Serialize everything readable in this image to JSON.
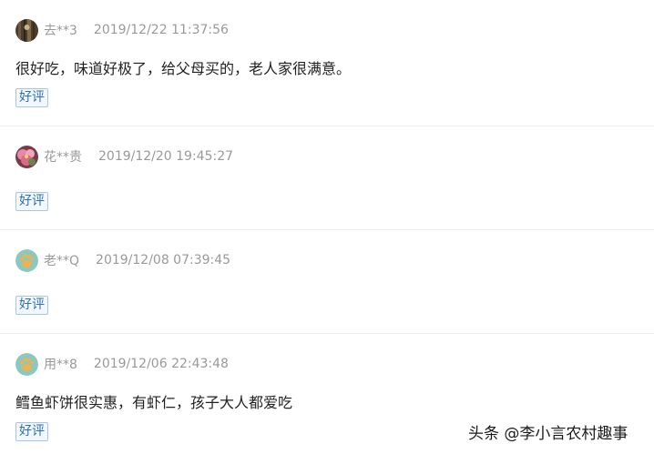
{
  "reviews": [
    {
      "username": "去**3",
      "timestamp": "2019/12/22 11:37:56",
      "comment": "很好吃，味道好极了，给父母买的，老人家很满意。",
      "badge": "好评",
      "avatar_icon": "avatar-dark-photo-icon"
    },
    {
      "username": "花**贵",
      "timestamp": "2019/12/20 19:45:27",
      "comment": "",
      "badge": "好评",
      "avatar_icon": "avatar-flower-photo-icon"
    },
    {
      "username": "老**Q",
      "timestamp": "2019/12/08 07:39:45",
      "comment": "",
      "badge": "好评",
      "avatar_icon": "avatar-default-paw-icon"
    },
    {
      "username": "用**8",
      "timestamp": "2019/12/06 22:43:48",
      "comment": "鳕鱼虾饼很实惠，有虾仁，孩子大人都爱吃",
      "badge": "好评",
      "avatar_icon": "avatar-default-paw-icon"
    }
  ],
  "watermark": "头条 @李小言农村趣事",
  "colors": {
    "meta_text": "#999999",
    "comment_text": "#222222",
    "badge_text": "#2f6fb8",
    "badge_border": "#a9c6e8",
    "badge_bg": "#f2f7fd",
    "divider": "#ececec",
    "default_avatar_bg": "#8cc8c0",
    "default_avatar_paw": "#f0b24a"
  }
}
